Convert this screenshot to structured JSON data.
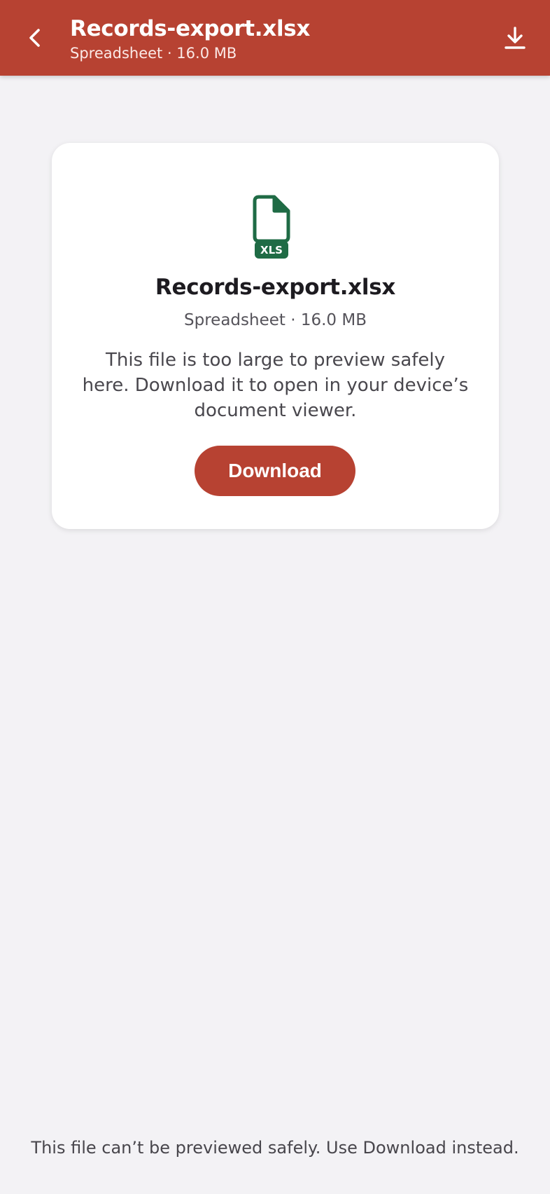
{
  "appbar": {
    "title": "Records-export.xlsx",
    "subtitle": "Spreadsheet · 16.0 MB",
    "back_icon": "chevron-left-icon",
    "download_icon": "download-icon"
  },
  "card": {
    "file_icon": "spreadsheet-file-icon",
    "file_badge": "XLS",
    "title": "Records-export.xlsx",
    "meta": "Spreadsheet · 16.0 MB",
    "message": "This file is too large to preview safely here. Download it to open in your device’s document viewer.",
    "download_label": "Download"
  },
  "footer": {
    "note": "This file can’t be previewed safely. Use Download instead."
  },
  "colors": {
    "accent": "#b74232",
    "file_icon": "#1f6b45",
    "background": "#f3f2f5"
  }
}
